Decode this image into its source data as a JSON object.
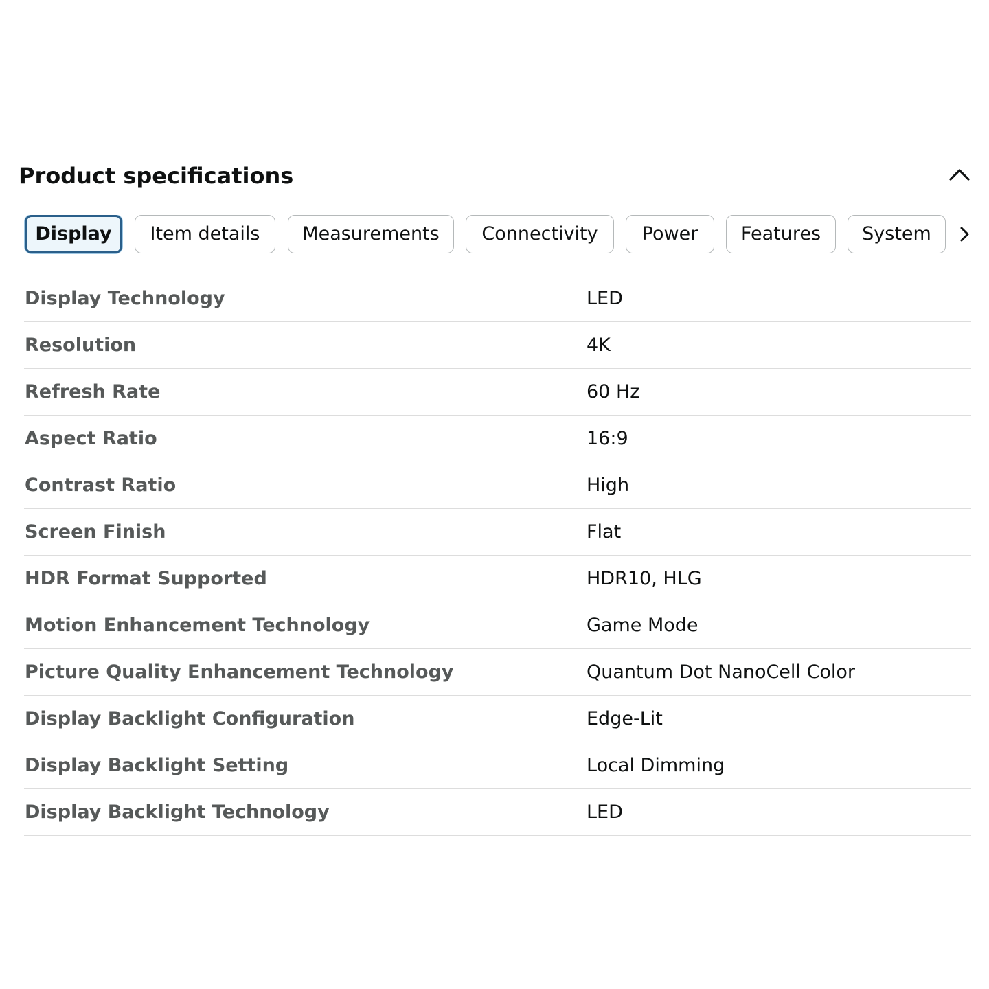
{
  "section": {
    "title": "Product specifications",
    "collapse_icon": "chevron-up-icon"
  },
  "tabs": [
    {
      "label": "Display",
      "active": true
    },
    {
      "label": "Item details",
      "active": false
    },
    {
      "label": "Measurements",
      "active": false
    },
    {
      "label": "Connectivity",
      "active": false
    },
    {
      "label": "Power",
      "active": false
    },
    {
      "label": "Features",
      "active": false
    },
    {
      "label": "System",
      "active": false
    }
  ],
  "tabs_scroll_icon": "chevron-right-icon",
  "specs": [
    {
      "label": "Display Technology",
      "value": "LED"
    },
    {
      "label": "Resolution",
      "value": "4K"
    },
    {
      "label": "Refresh Rate",
      "value": "60 Hz"
    },
    {
      "label": "Aspect Ratio",
      "value": "16:9"
    },
    {
      "label": "Contrast Ratio",
      "value": "High"
    },
    {
      "label": "Screen Finish",
      "value": "Flat"
    },
    {
      "label": "HDR Format Supported",
      "value": "HDR10, HLG"
    },
    {
      "label": "Motion Enhancement Technology",
      "value": "Game Mode"
    },
    {
      "label": "Picture Quality Enhancement Technology",
      "value": "Quantum Dot NanoCell Color"
    },
    {
      "label": "Display Backlight Configuration",
      "value": "Edge-Lit"
    },
    {
      "label": "Display Backlight Setting",
      "value": "Local Dimming"
    },
    {
      "label": "Display Backlight Technology",
      "value": "LED"
    }
  ],
  "colors": {
    "active_tab_border": "#2a5f8a",
    "active_tab_bg": "#edf6fb",
    "label_text": "#565959",
    "value_text": "#0f1111",
    "divider": "#dddddd"
  }
}
